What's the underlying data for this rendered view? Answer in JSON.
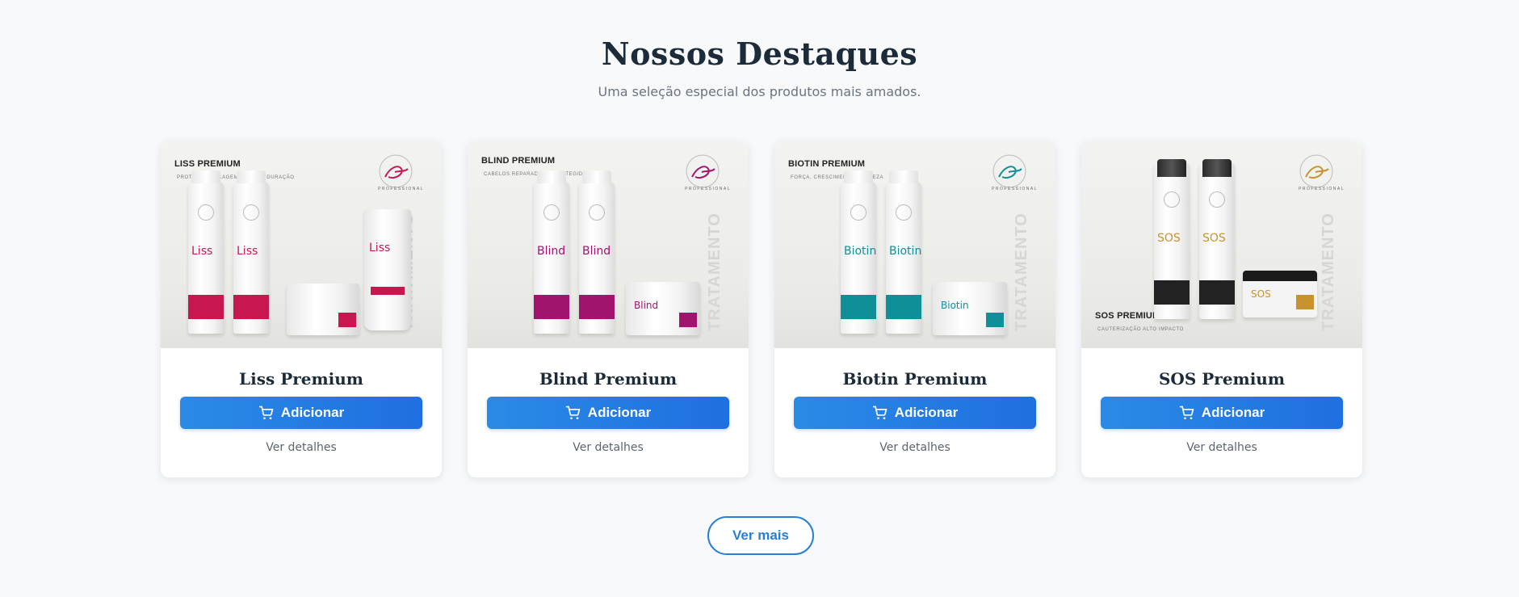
{
  "section": {
    "title": "Nossos Destaques",
    "subtitle": "Uma seleção especial dos produtos mais amados."
  },
  "products": [
    {
      "name": "Liss Premium",
      "image_brand": "LISS PREMIUM",
      "image_tagline": "PROTEÇÃO, SELAGEM E LONGA DURAÇÃO",
      "image_side_text": "TRATAMENTO",
      "image_product_word": "Liss",
      "accent_color": "#c8174f",
      "add_label": "Adicionar",
      "details_label": "Ver detalhes"
    },
    {
      "name": "Blind Premium",
      "image_brand": "BLIND PREMIUM",
      "image_tagline": "CABELOS REPARADOS E PROTEGIDOS",
      "image_side_text": "TRATAMENTO",
      "image_product_word": "Blind",
      "accent_color": "#a0146e",
      "add_label": "Adicionar",
      "details_label": "Ver detalhes"
    },
    {
      "name": "Biotin Premium",
      "image_brand": "BIOTIN PREMIUM",
      "image_tagline": "FORÇA, CRESCIMENTO E BELEZA",
      "image_side_text": "TRATAMENTO",
      "image_product_word": "Biotin",
      "accent_color": "#0f8f97",
      "add_label": "Adicionar",
      "details_label": "Ver detalhes"
    },
    {
      "name": "SOS Premium",
      "image_brand": "SOS PREMIUM",
      "image_tagline": "CAUTERIZAÇÃO ALTO IMPACTO",
      "image_side_text": "TRATAMENTO",
      "image_product_word": "SOS",
      "accent_color": "#c8922e",
      "add_label": "Adicionar",
      "details_label": "Ver detalhes"
    }
  ],
  "more_button": "Ver mais",
  "icons": {
    "cart": "cart-icon",
    "logo": "brand-logo"
  },
  "colors": {
    "primary": "#1f6fe0",
    "heading": "#1c2b3a",
    "background": "#f7f9fb"
  }
}
